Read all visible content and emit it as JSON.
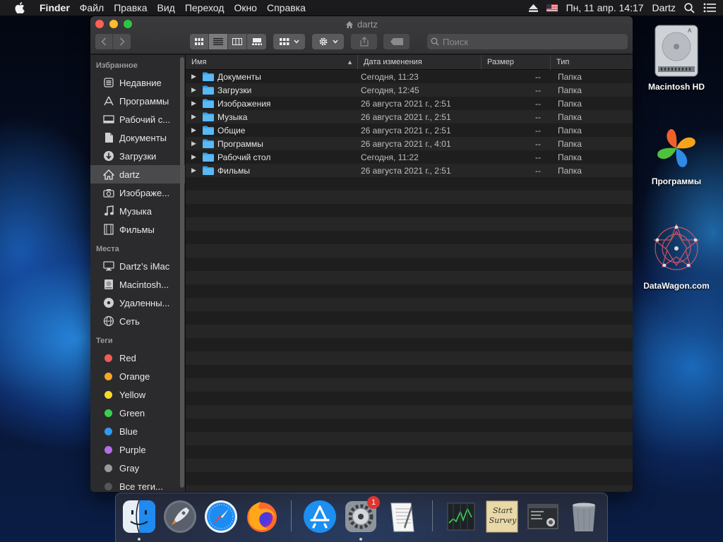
{
  "menubar": {
    "app_name": "Finder",
    "items": [
      "Файл",
      "Правка",
      "Вид",
      "Переход",
      "Окно",
      "Справка"
    ],
    "datetime": "Пн, 11 апр.  14:17",
    "user": "Dartz"
  },
  "window": {
    "title": "dartz",
    "search_placeholder": "Поиск"
  },
  "sidebar": {
    "favorites_header": "Избранное",
    "favorites": [
      {
        "label": "Недавние",
        "icon": "recents-icon"
      },
      {
        "label": "Программы",
        "icon": "applications-icon"
      },
      {
        "label": "Рабочий с...",
        "icon": "desktop-icon"
      },
      {
        "label": "Документы",
        "icon": "documents-icon"
      },
      {
        "label": "Загрузки",
        "icon": "downloads-icon"
      },
      {
        "label": "dartz",
        "icon": "home-icon"
      },
      {
        "label": "Изображе...",
        "icon": "camera-icon"
      },
      {
        "label": "Музыка",
        "icon": "music-icon"
      },
      {
        "label": "Фильмы",
        "icon": "movies-icon"
      }
    ],
    "places_header": "Места",
    "places": [
      {
        "label": "Dartz’s iMac",
        "icon": "imac-icon"
      },
      {
        "label": "Macintosh...",
        "icon": "hard-drive-icon"
      },
      {
        "label": "Удаленны...",
        "icon": "disc-icon"
      },
      {
        "label": "Сеть",
        "icon": "network-icon"
      }
    ],
    "tags_header": "Теги",
    "tags": [
      {
        "label": "Red",
        "color": "#f25c54"
      },
      {
        "label": "Orange",
        "color": "#f5a623"
      },
      {
        "label": "Yellow",
        "color": "#f8d92a"
      },
      {
        "label": "Green",
        "color": "#3ccf4e"
      },
      {
        "label": "Blue",
        "color": "#2e9bf0"
      },
      {
        "label": "Purple",
        "color": "#b46ee8"
      },
      {
        "label": "Gray",
        "color": "#9a9a9a"
      },
      {
        "label": "Все теги...",
        "color": "#555555"
      }
    ]
  },
  "list": {
    "columns": {
      "name": "Имя",
      "date": "Дата изменения",
      "size": "Размер",
      "kind": "Тип"
    },
    "rows": [
      {
        "name": "Документы",
        "date": "Сегодня, 11:23",
        "size": "--",
        "kind": "Папка"
      },
      {
        "name": "Загрузки",
        "date": "Сегодня, 12:45",
        "size": "--",
        "kind": "Папка"
      },
      {
        "name": "Изображения",
        "date": "26 августа 2021 г., 2:51",
        "size": "--",
        "kind": "Папка"
      },
      {
        "name": "Музыка",
        "date": "26 августа 2021 г., 2:51",
        "size": "--",
        "kind": "Папка"
      },
      {
        "name": "Общие",
        "date": "26 августа 2021 г., 2:51",
        "size": "--",
        "kind": "Папка"
      },
      {
        "name": "Программы",
        "date": "26 августа 2021 г., 4:01",
        "size": "--",
        "kind": "Папка"
      },
      {
        "name": "Рабочий стол",
        "date": "Сегодня, 11:22",
        "size": "--",
        "kind": "Папка"
      },
      {
        "name": "Фильмы",
        "date": "26 августа 2021 г., 2:51",
        "size": "--",
        "kind": "Папка"
      }
    ]
  },
  "desktop": {
    "icons": [
      {
        "label": "Macintosh HD"
      },
      {
        "label": "Программы"
      },
      {
        "label": "DataWagon.com"
      }
    ]
  },
  "dock": {
    "settings_badge": "1",
    "stickies_text": "Start Survey"
  }
}
